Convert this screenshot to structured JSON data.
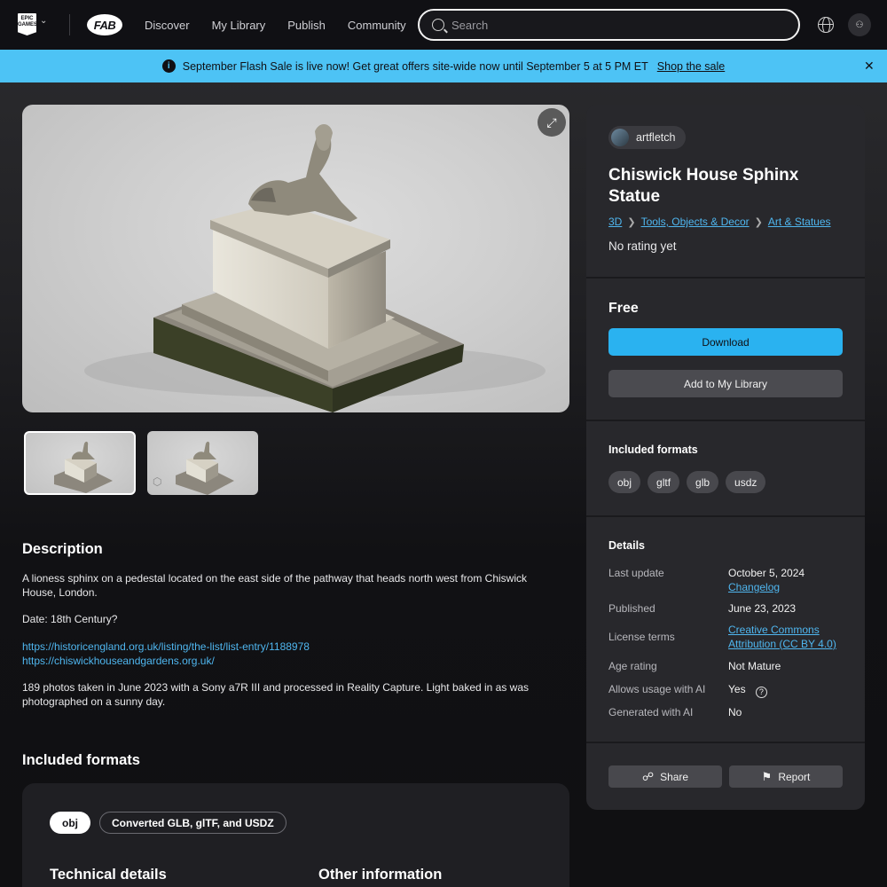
{
  "nav": {
    "epic_logo": "EPIC GAMES",
    "fab_logo": "FAB",
    "links": [
      "Discover",
      "My Library",
      "Publish",
      "Community"
    ],
    "search_placeholder": "Search"
  },
  "banner": {
    "text": "September Flash Sale is live now! Get great offers site-wide now until September 5 at 5 PM ET",
    "link": "Shop the sale",
    "color": "#4dc3f5"
  },
  "product": {
    "author": "artfletch",
    "title": "Chiswick House Sphinx Statue",
    "breadcrumbs": [
      "3D",
      "Tools, Objects & Decor",
      "Art & Statues"
    ],
    "rating": "No rating yet",
    "price": "Free",
    "download_label": "Download",
    "library_label": "Add to My Library",
    "accent": "#2ab2f0"
  },
  "side_formats": {
    "heading": "Included formats",
    "items": [
      "obj",
      "gltf",
      "glb",
      "usdz"
    ]
  },
  "details": {
    "heading": "Details",
    "last_update_label": "Last update",
    "last_update": "October 5, 2024",
    "changelog": "Changelog",
    "published_label": "Published",
    "published": "June 23, 2023",
    "license_label": "License terms",
    "license_line1": "Creative Commons",
    "license_line2": "Attribution (CC BY 4.0)",
    "age_label": "Age rating",
    "age": "Not Mature",
    "ai_usage_label": "Allows usage with AI",
    "ai_usage": "Yes",
    "generated_label": "Generated with AI",
    "generated": "No"
  },
  "actions": {
    "share": "Share",
    "report": "Report"
  },
  "description": {
    "heading": "Description",
    "p1": "A lioness sphinx on a pedestal located on the east side of the pathway that heads north west from Chiswick House, London.",
    "p2": "Date: 18th Century?",
    "link1": "https://historicengland.org.uk/listing/the-list/list-entry/1188978",
    "link2": "https://chiswickhouseandgardens.org.uk/",
    "p3": "189 photos taken in June 2023 with a Sony a7R III and processed in Reality Capture. Light baked in as was photographed on a sunny day."
  },
  "lower_formats": {
    "heading": "Included formats",
    "selected": "obj",
    "other": "Converted GLB, glTF, and USDZ",
    "technical_heading": "Technical details",
    "other_heading": "Other information"
  }
}
